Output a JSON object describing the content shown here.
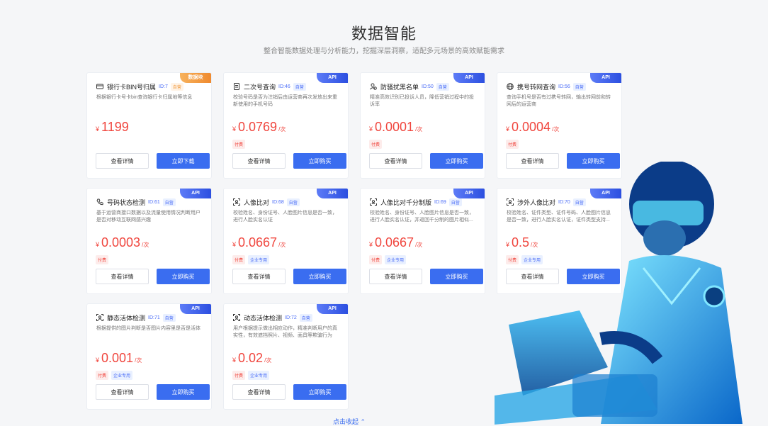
{
  "header": {
    "title": "数据智能",
    "subtitle": "整合智能数据处理与分析能力，挖掘深层洞察，适配多元场景的高效赋能需求"
  },
  "cards": [
    {
      "name": "银行卡BIN号归属",
      "id": "ID:7",
      "tag": "自营",
      "ribbon": "数据块",
      "ribbon_type": "data",
      "desc": "根据银行卡号卡bin查询银行卡归属地等信息",
      "currency": "¥",
      "price": "1199",
      "unit": "",
      "badges": [],
      "detail_label": "查看详情",
      "buy_label": "立即下载",
      "icon": "card-icon"
    },
    {
      "name": "二次号查询",
      "id": "ID:46",
      "tag": "自营",
      "ribbon": "API",
      "ribbon_type": "api",
      "desc": "校验号码是否为注销后由运营商再次发放出来重新使用的手机号码",
      "currency": "¥",
      "price": "0.0769",
      "unit": "/次",
      "badges": [
        "付费"
      ],
      "detail_label": "查看详情",
      "buy_label": "立即购买",
      "icon": "document-icon"
    },
    {
      "name": "防骚扰黑名单",
      "id": "ID:50",
      "tag": "自营",
      "ribbon": "API",
      "ribbon_type": "api",
      "desc": "精准高效识别已投诉人员，降低营销过程中的投诉率",
      "currency": "¥",
      "price": "0.0001",
      "unit": "/次",
      "badges": [
        "付费"
      ],
      "detail_label": "查看详情",
      "buy_label": "立即购买",
      "icon": "user-block-icon"
    },
    {
      "name": "携号转网查询",
      "id": "ID:56",
      "tag": "自营",
      "ribbon": "API",
      "ribbon_type": "api",
      "desc": "查询手机号是否有过携号转网，输出转网前和转网后的运营商",
      "currency": "¥",
      "price": "0.0004",
      "unit": "/次",
      "badges": [
        "付费"
      ],
      "detail_label": "查看详情",
      "buy_label": "立即购买",
      "icon": "globe-icon"
    },
    {
      "name": "号码状态检测",
      "id": "ID:61",
      "tag": "自营",
      "ribbon": "API",
      "ribbon_type": "api",
      "desc": "基于运营商接口数据以及流量使用情况判断用户是否对移动互联网感兴趣",
      "currency": "¥",
      "price": "0.0003",
      "unit": "/次",
      "badges": [
        "付费"
      ],
      "detail_label": "查看详情",
      "buy_label": "立即购买",
      "icon": "phone-icon"
    },
    {
      "name": "人像比对",
      "id": "ID:68",
      "tag": "自营",
      "ribbon": "API",
      "ribbon_type": "api",
      "desc": "校验姓名、身份证号、人脸图片信息是否一致，进行人脸实名认证",
      "currency": "¥",
      "price": "0.0667",
      "unit": "/次",
      "badges": [
        "付费",
        "企业专用"
      ],
      "detail_label": "查看详情",
      "buy_label": "立即购买",
      "icon": "face-scan-icon"
    },
    {
      "name": "人像比对千分制版",
      "id": "ID:69",
      "tag": "自营",
      "ribbon": "API",
      "ribbon_type": "api",
      "desc": "校验姓名、身份证号、人脸图片信息是否一致，进行人脸实名认证，并返回千分制的图片相似...",
      "currency": "¥",
      "price": "0.0667",
      "unit": "/次",
      "badges": [
        "付费",
        "企业专用"
      ],
      "detail_label": "查看详情",
      "buy_label": "立即购买",
      "icon": "face-scan-icon"
    },
    {
      "name": "涉外人像比对",
      "id": "ID:70",
      "tag": "自营",
      "ribbon": "API",
      "ribbon_type": "api",
      "desc": "校验姓名、证件类型、证件号码、人脸图片信息是否一致，进行人脸实名认证，证件类型支持...",
      "currency": "¥",
      "price": "0.5",
      "unit": "/次",
      "badges": [
        "付费",
        "企业专用"
      ],
      "detail_label": "查看详情",
      "buy_label": "立即购买",
      "icon": "face-scan-icon"
    },
    {
      "name": "静态活体检测",
      "id": "ID:71",
      "tag": "自营",
      "ribbon": "API",
      "ribbon_type": "api",
      "desc": "根据提供的图片判断是否图片内容里是否是活体",
      "currency": "¥",
      "price": "0.001",
      "unit": "/次",
      "badges": [
        "付费",
        "企业专用"
      ],
      "detail_label": "查看详情",
      "buy_label": "立即购买",
      "icon": "face-scan-icon"
    },
    {
      "name": "动态活体检测",
      "id": "ID:72",
      "tag": "自营",
      "ribbon": "API",
      "ribbon_type": "api",
      "desc": "用户根据提示做出相应动作，精准判断用户的真实性，有效遮挡照片、视频、面具等欺骗行为",
      "currency": "¥",
      "price": "0.02",
      "unit": "/次",
      "badges": [
        "付费",
        "企业专用"
      ],
      "detail_label": "查看详情",
      "buy_label": "立即购买",
      "icon": "face-scan-icon"
    }
  ],
  "footer": {
    "collapse_label": "点击收起 ⌃"
  }
}
